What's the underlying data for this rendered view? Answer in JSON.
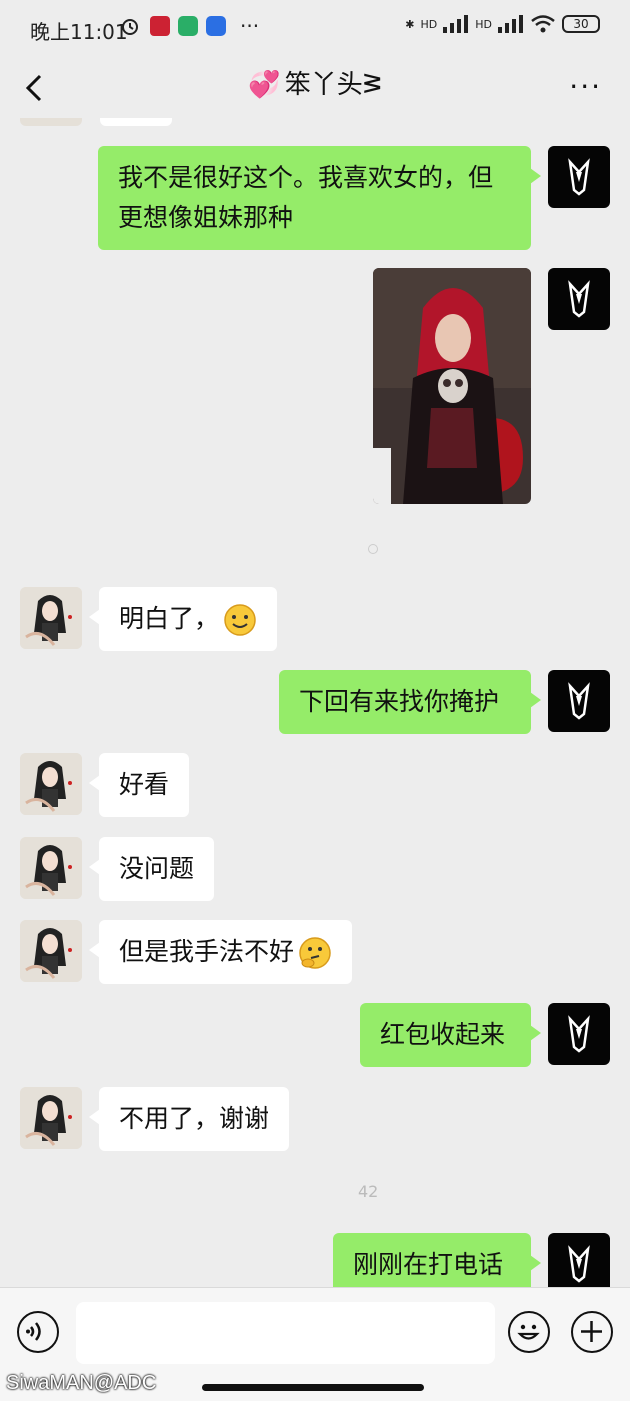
{
  "status_bar": {
    "time": "晚上11:01",
    "dots": "···",
    "signal1": "HD",
    "signal2": "HD",
    "battery": "30"
  },
  "nav": {
    "title": "笨丫头",
    "title_suffix": "ᕒ",
    "more": "···"
  },
  "messages": [
    {
      "from": "me",
      "text": "我不是很好这个。我喜欢女的，但更想像姐妹那种"
    },
    {
      "from": "me",
      "type": "image"
    },
    {
      "from": "her",
      "text": "明白了，",
      "emoji": "smile"
    },
    {
      "from": "me",
      "text": "下回有来找你掩护"
    },
    {
      "from": "her",
      "text": "好看"
    },
    {
      "from": "her",
      "text": "没问题"
    },
    {
      "from": "her",
      "text": "但是我手法不好",
      "emoji": "thinking"
    },
    {
      "from": "me",
      "text": "红包收起来"
    },
    {
      "from": "her",
      "text": "不用了，谢谢"
    },
    {
      "from": "me",
      "text": "刚刚在打电话"
    }
  ],
  "faint_number": "42",
  "input": {
    "placeholder": ""
  },
  "watermark": "SiwaMAN@ADC",
  "colors": {
    "me_bubble": "#95ec69",
    "her_bubble": "#ffffff",
    "background": "#ededed"
  }
}
